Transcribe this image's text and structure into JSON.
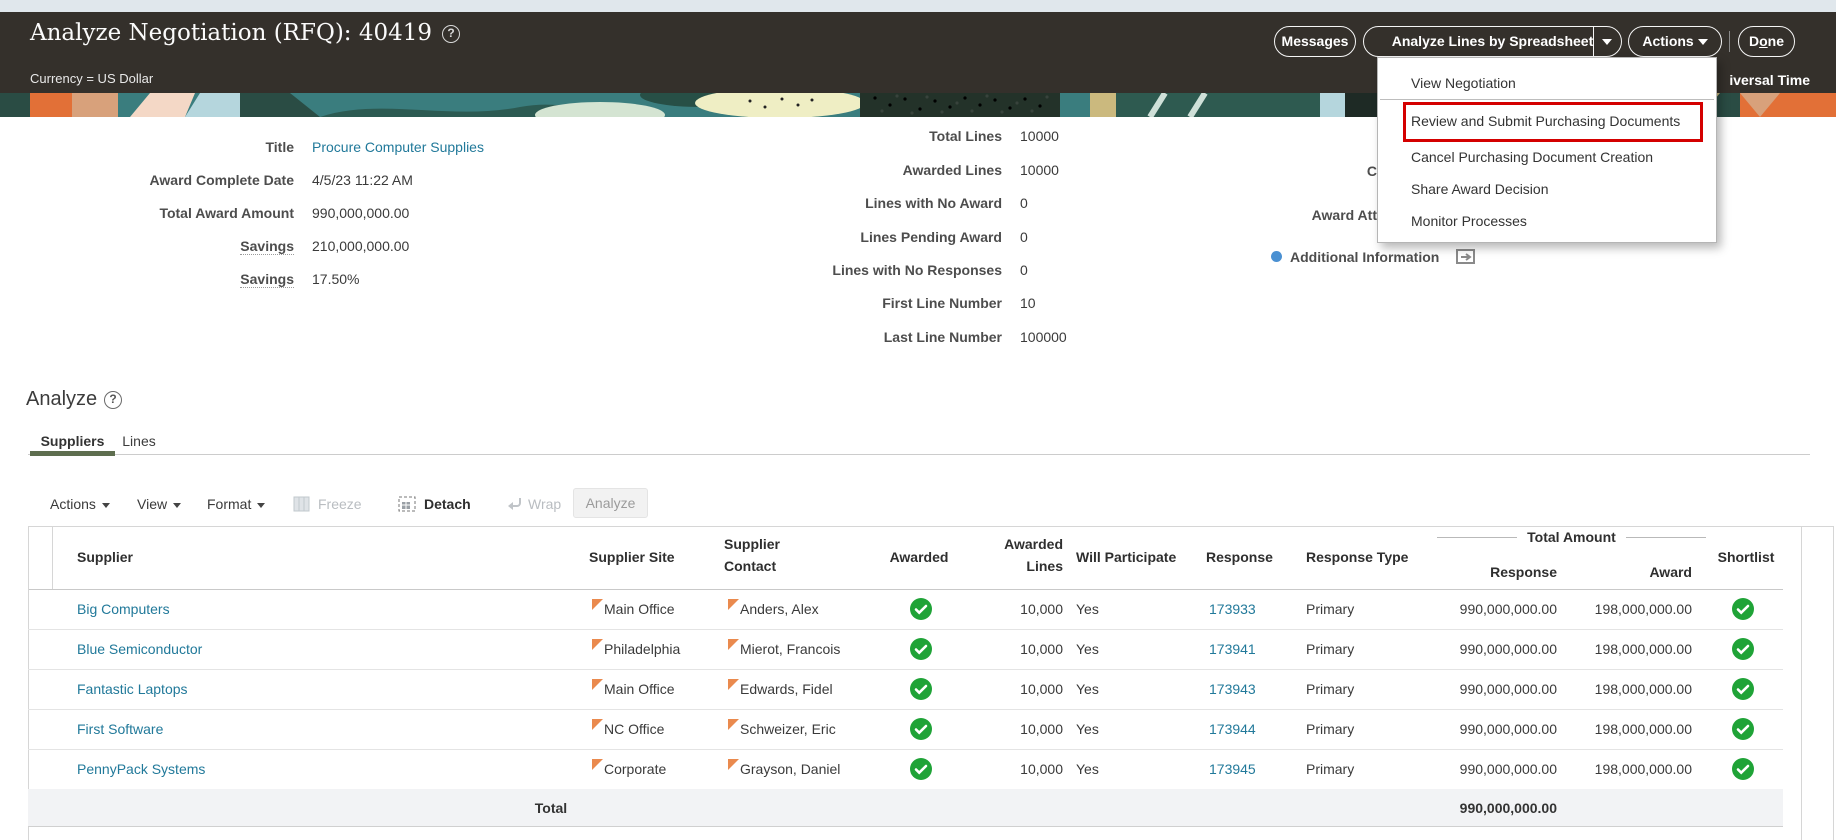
{
  "header": {
    "title": "Analyze Negotiation (RFQ): 40419",
    "currency_note": "Currency = US Dollar",
    "timezone_fragment": "iversal Time",
    "messages_label": "Messages",
    "spreadsheet_label": "Analyze Lines by Spreadsheet",
    "actions_label": "Actions",
    "done_label_prefix": "D",
    "done_label_accesskey": "o",
    "done_label_suffix": "ne"
  },
  "actions_menu": {
    "items": [
      "View Negotiation",
      "Review and Submit Purchasing Documents",
      "Cancel Purchasing Document Creation",
      "Share Award Decision",
      "Monitor Processes"
    ]
  },
  "summary": {
    "fields_left": [
      {
        "label": "Title",
        "value": "Procure Computer Supplies"
      },
      {
        "label": "Award Complete Date",
        "value": "4/5/23 11:22 AM"
      },
      {
        "label": "Total Award Amount",
        "value": "990,000,000.00"
      },
      {
        "label": "Savings",
        "value": "210,000,000.00"
      },
      {
        "label": "Savings",
        "value": "17.50%"
      }
    ],
    "fields_middle": [
      {
        "label": "Total Lines",
        "value": "10000"
      },
      {
        "label": "Awarded Lines",
        "value": "10000"
      },
      {
        "label": "Lines with No Award",
        "value": "0"
      },
      {
        "label": "Lines Pending Award",
        "value": "0"
      },
      {
        "label": "Lines with No Responses",
        "value": "0"
      },
      {
        "label": "First Line Number",
        "value": "10"
      },
      {
        "label": "Last Line Number",
        "value": "100000"
      }
    ],
    "right_fragment_1": "C",
    "right_fragment_2": "Award Att",
    "additional_information_label": "Additional Information"
  },
  "analyze_section": {
    "heading": "Analyze",
    "tab_suppliers": "Suppliers",
    "tab_lines": "Lines"
  },
  "toolbar": {
    "actions": "Actions",
    "view": "View",
    "format": "Format",
    "freeze": "Freeze",
    "detach": "Detach",
    "wrap": "Wrap",
    "analyze": "Analyze"
  },
  "table": {
    "headers": {
      "supplier": "Supplier",
      "supplier_site": "Supplier Site",
      "supplier_contact_l1": "Supplier",
      "supplier_contact_l2": "Contact",
      "awarded": "Awarded",
      "awarded_lines_l1": "Awarded",
      "awarded_lines_l2": "Lines",
      "will_participate": "Will Participate",
      "response": "Response",
      "response_type": "Response Type",
      "total_amount_group": "Total Amount",
      "sub_response": "Response",
      "sub_award": "Award",
      "shortlist": "Shortlist"
    },
    "rows": [
      {
        "supplier": "Big Computers",
        "site": "Main Office",
        "contact": "Anders, Alex",
        "awarded_lines": "10,000",
        "will_participate": "Yes",
        "response": "173933",
        "response_type": "Primary",
        "total_response": "990,000,000.00",
        "total_award": "198,000,000.00"
      },
      {
        "supplier": "Blue Semiconductor",
        "site": "Philadelphia",
        "contact": "Mierot, Francois",
        "awarded_lines": "10,000",
        "will_participate": "Yes",
        "response": "173941",
        "response_type": "Primary",
        "total_response": "990,000,000.00",
        "total_award": "198,000,000.00"
      },
      {
        "supplier": "Fantastic Laptops",
        "site": "Main Office",
        "contact": "Edwards, Fidel",
        "awarded_lines": "10,000",
        "will_participate": "Yes",
        "response": "173943",
        "response_type": "Primary",
        "total_response": "990,000,000.00",
        "total_award": "198,000,000.00"
      },
      {
        "supplier": "First Software",
        "site": "NC Office",
        "contact": "Schweizer, Eric",
        "awarded_lines": "10,000",
        "will_participate": "Yes",
        "response": "173944",
        "response_type": "Primary",
        "total_response": "990,000,000.00",
        "total_award": "198,000,000.00"
      },
      {
        "supplier": "PennyPack Systems",
        "site": "Corporate",
        "contact": "Grayson, Daniel",
        "awarded_lines": "10,000",
        "will_participate": "Yes",
        "response": "173945",
        "response_type": "Primary",
        "total_response": "990,000,000.00",
        "total_award": "198,000,000.00"
      }
    ],
    "total_label": "Total",
    "total_value": "990,000,000.00"
  },
  "colors": {
    "link": "#21799a",
    "check_green": "#1fa337",
    "flag_orange": "#ea8a4e",
    "highlight_red": "#d40000",
    "tab_underline": "#5e6e4f",
    "info_dot_blue": "#4a90d2",
    "header_bg": "#34302b"
  }
}
